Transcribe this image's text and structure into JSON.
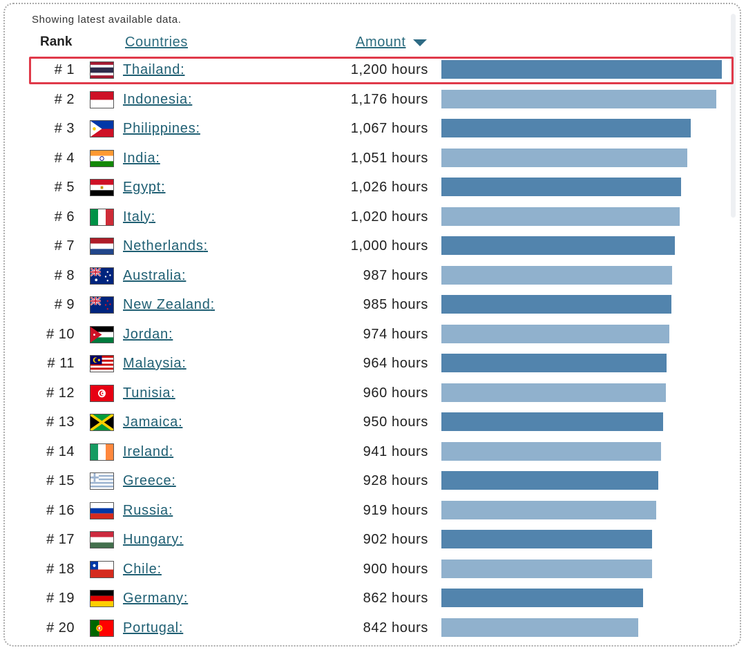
{
  "note": "Showing latest available data.",
  "headers": {
    "rank": "Rank",
    "countries": "Countries",
    "amount": "Amount"
  },
  "colors": {
    "bar_dark": "#5284ad",
    "bar_light": "#90b1cd",
    "link": "#1f5f73",
    "highlight": "#e03a4a"
  },
  "rows": [
    {
      "rank": "# 1",
      "country": "Thailand",
      "amount": "1,200 hours",
      "flag": "thailand-flag-icon"
    },
    {
      "rank": "# 2",
      "country": "Indonesia",
      "amount": "1,176 hours",
      "flag": "indonesia-flag-icon"
    },
    {
      "rank": "# 3",
      "country": "Philippines",
      "amount": "1,067 hours",
      "flag": "philippines-flag-icon"
    },
    {
      "rank": "# 4",
      "country": "India",
      "amount": "1,051 hours",
      "flag": "india-flag-icon"
    },
    {
      "rank": "# 5",
      "country": "Egypt",
      "amount": "1,026 hours",
      "flag": "egypt-flag-icon"
    },
    {
      "rank": "# 6",
      "country": "Italy",
      "amount": "1,020 hours",
      "flag": "italy-flag-icon"
    },
    {
      "rank": "# 7",
      "country": "Netherlands",
      "amount": "1,000 hours",
      "flag": "netherlands-flag-icon"
    },
    {
      "rank": "# 8",
      "country": "Australia",
      "amount": "987 hours",
      "flag": "australia-flag-icon"
    },
    {
      "rank": "# 9",
      "country": "New Zealand",
      "amount": "985 hours",
      "flag": "new-zealand-flag-icon"
    },
    {
      "rank": "# 10",
      "country": "Jordan",
      "amount": "974 hours",
      "flag": "jordan-flag-icon"
    },
    {
      "rank": "# 11",
      "country": "Malaysia",
      "amount": "964 hours",
      "flag": "malaysia-flag-icon"
    },
    {
      "rank": "# 12",
      "country": "Tunisia",
      "amount": "960 hours",
      "flag": "tunisia-flag-icon"
    },
    {
      "rank": "# 13",
      "country": "Jamaica",
      "amount": "950 hours",
      "flag": "jamaica-flag-icon"
    },
    {
      "rank": "# 14",
      "country": "Ireland",
      "amount": "941 hours",
      "flag": "ireland-flag-icon"
    },
    {
      "rank": "# 15",
      "country": "Greece",
      "amount": "928 hours",
      "flag": "greece-flag-icon"
    },
    {
      "rank": "# 16",
      "country": "Russia",
      "amount": "919 hours",
      "flag": "russia-flag-icon"
    },
    {
      "rank": "# 17",
      "country": "Hungary",
      "amount": "902 hours",
      "flag": "hungary-flag-icon"
    },
    {
      "rank": "# 18",
      "country": "Chile",
      "amount": "900 hours",
      "flag": "chile-flag-icon"
    },
    {
      "rank": "# 19",
      "country": "Germany",
      "amount": "862 hours",
      "flag": "germany-flag-icon"
    },
    {
      "rank": "# 20",
      "country": "Portugal",
      "amount": "842 hours",
      "flag": "portugal-flag-icon"
    }
  ],
  "chart_data": {
    "type": "bar",
    "orientation": "horizontal",
    "categories": [
      "Thailand",
      "Indonesia",
      "Philippines",
      "India",
      "Egypt",
      "Italy",
      "Netherlands",
      "Australia",
      "New Zealand",
      "Jordan",
      "Malaysia",
      "Tunisia",
      "Jamaica",
      "Ireland",
      "Greece",
      "Russia",
      "Hungary",
      "Chile",
      "Germany",
      "Portugal"
    ],
    "values": [
      1200,
      1176,
      1067,
      1051,
      1026,
      1020,
      1000,
      987,
      985,
      974,
      964,
      960,
      950,
      941,
      928,
      919,
      902,
      900,
      862,
      842
    ],
    "unit": "hours",
    "xlim": [
      0,
      1200
    ],
    "highlighted_category": "Thailand",
    "grid": false,
    "legend": "none"
  }
}
